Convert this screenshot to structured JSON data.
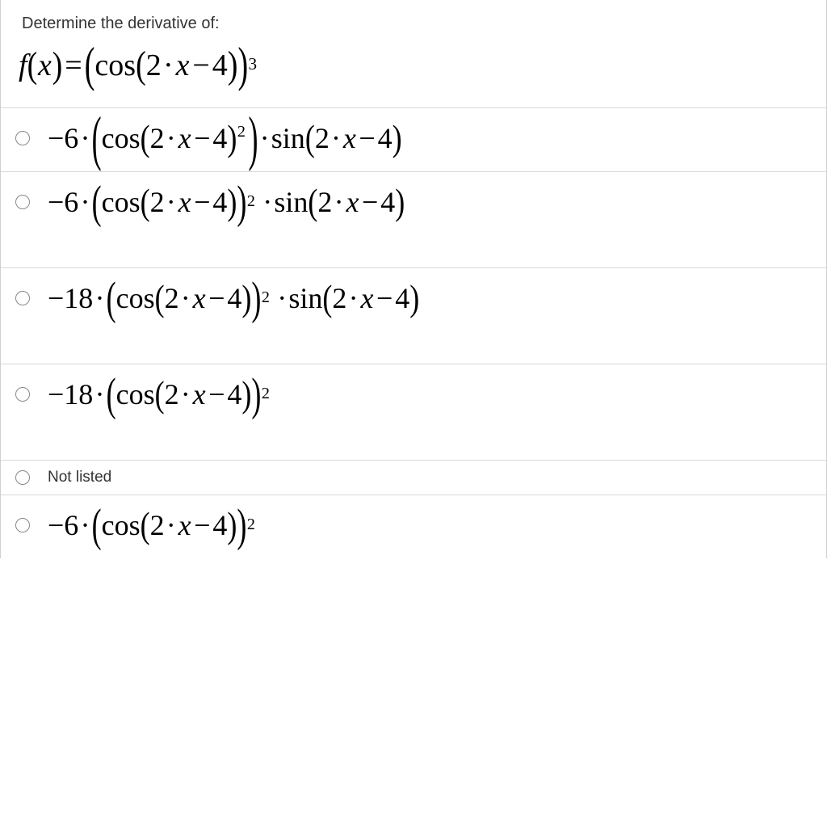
{
  "prompt": "Determine the derivative of:",
  "function": {
    "lhs_f": "f",
    "lhs_x": "x",
    "eq": "=",
    "cos": "cos",
    "inner_coef": "2",
    "inner_x": "x",
    "inner_const": "4",
    "outer_exp": "3"
  },
  "options": [
    {
      "type": "math",
      "coef": "−6",
      "cos": "cos",
      "inner_coef": "2",
      "inner_x": "x",
      "inner_const": "4",
      "inner_exp_inside": "2",
      "sin": "sin",
      "sin_coef": "2",
      "sin_x": "x",
      "sin_const": "4"
    },
    {
      "type": "math",
      "coef": "−6",
      "cos": "cos",
      "inner_coef": "2",
      "inner_x": "x",
      "inner_const": "4",
      "outer_exp": "2",
      "sin": "sin",
      "sin_coef": "2",
      "sin_x": "x",
      "sin_const": "4"
    },
    {
      "type": "math",
      "coef": "−18",
      "cos": "cos",
      "inner_coef": "2",
      "inner_x": "x",
      "inner_const": "4",
      "outer_exp": "2",
      "sin": "sin",
      "sin_coef": "2",
      "sin_x": "x",
      "sin_const": "4"
    },
    {
      "type": "math",
      "coef": "−18",
      "cos": "cos",
      "inner_coef": "2",
      "inner_x": "x",
      "inner_const": "4",
      "outer_exp": "2"
    },
    {
      "type": "text",
      "label": "Not listed"
    },
    {
      "type": "math",
      "coef": "−6",
      "cos": "cos",
      "inner_coef": "2",
      "inner_x": "x",
      "inner_const": "4",
      "outer_exp": "2"
    }
  ]
}
